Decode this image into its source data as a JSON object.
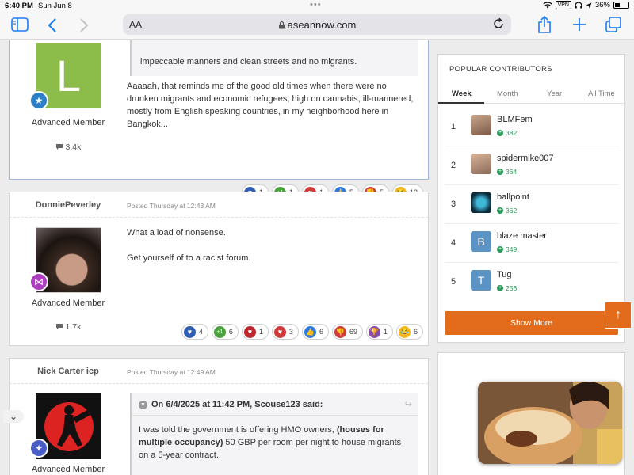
{
  "status": {
    "time": "6:40 PM",
    "date": "Sun Jun 8",
    "vpn": "VPN",
    "battery": "36%"
  },
  "browser": {
    "text_size_label": "AA",
    "url": "aseannow.com"
  },
  "posts": [
    {
      "avatar_letter": "L",
      "member_title": "Advanced Member",
      "reputation": "3.4k",
      "quote_text": "impeccable manners and clean streets and no migrants.",
      "body": "Aaaaah, that reminds me of the good old times when there were no drunken migrants and economic refugees, high on cannabis, ill-mannered, mostly from English speaking countries, in  my neighborhood here in Bangkok...",
      "reactions": [
        {
          "icon": "heart-icon",
          "count": "1",
          "color": "#2f5fb3"
        },
        {
          "icon": "plus-one-icon",
          "count": "1",
          "color": "#4aa23c"
        },
        {
          "icon": "heart-icon",
          "count": "1",
          "color": "#d33a3a"
        },
        {
          "icon": "thumbs-up-icon",
          "count": "5",
          "color": "#2c7be5"
        },
        {
          "icon": "thumbs-down-icon",
          "count": "5",
          "color": "#d33a3a"
        },
        {
          "icon": "laugh-icon",
          "count": "13",
          "color": "#f2b91c"
        }
      ]
    },
    {
      "author": "DonniePeverley",
      "time": "Posted Thursday at 12:43 AM",
      "member_title": "Advanced Member",
      "reputation": "1.7k",
      "body_line1": "What a load of nonsense.",
      "body_line2": "Get yourself of to a racist forum.",
      "reactions": [
        {
          "icon": "heart-icon",
          "count": "4",
          "color": "#2f5fb3"
        },
        {
          "icon": "plus-one-icon",
          "count": "6",
          "color": "#4aa23c"
        },
        {
          "icon": "broken-heart-icon",
          "count": "1",
          "color": "#c0272d"
        },
        {
          "icon": "heart-icon",
          "count": "3",
          "color": "#d33a3a"
        },
        {
          "icon": "thumbs-up-icon",
          "count": "6",
          "color": "#2c7be5"
        },
        {
          "icon": "thumbs-down-icon",
          "count": "69",
          "color": "#d33a3a"
        },
        {
          "icon": "trophy-icon",
          "count": "1",
          "color": "#8a4aa8"
        },
        {
          "icon": "laugh-icon",
          "count": "6",
          "color": "#f2b91c"
        }
      ]
    },
    {
      "author": "Nick Carter icp",
      "time": "Posted Thursday at 12:49 AM",
      "member_title": "Advanced Member",
      "quote_header": "On 6/4/2025 at 11:42 PM, Scouse123 said:",
      "quote_pre": "I was told the government is offering HMO owners, ",
      "quote_bold": "(houses for multiple occupancy)",
      "quote_post": " 50 GBP per room per night to house migrants on a 5-year contract."
    }
  ],
  "sidebar": {
    "title": "POPULAR CONTRIBUTORS",
    "tabs": [
      "Week",
      "Month",
      "Year",
      "All Time"
    ],
    "contributors": [
      {
        "rank": "1",
        "name": "BLMFem",
        "points": "382"
      },
      {
        "rank": "2",
        "name": "spidermike007",
        "points": "364"
      },
      {
        "rank": "3",
        "name": "ballpoint",
        "points": "362"
      },
      {
        "rank": "4",
        "name": "blaze master",
        "points": "349",
        "letter": "B"
      },
      {
        "rank": "5",
        "name": "Tug",
        "points": "256",
        "letter": "T"
      }
    ],
    "show_more": "Show More"
  },
  "colors": {
    "accent": "#e36c1c",
    "link_blue": "#1a7cf5",
    "green_points": "#2a9a5a"
  }
}
